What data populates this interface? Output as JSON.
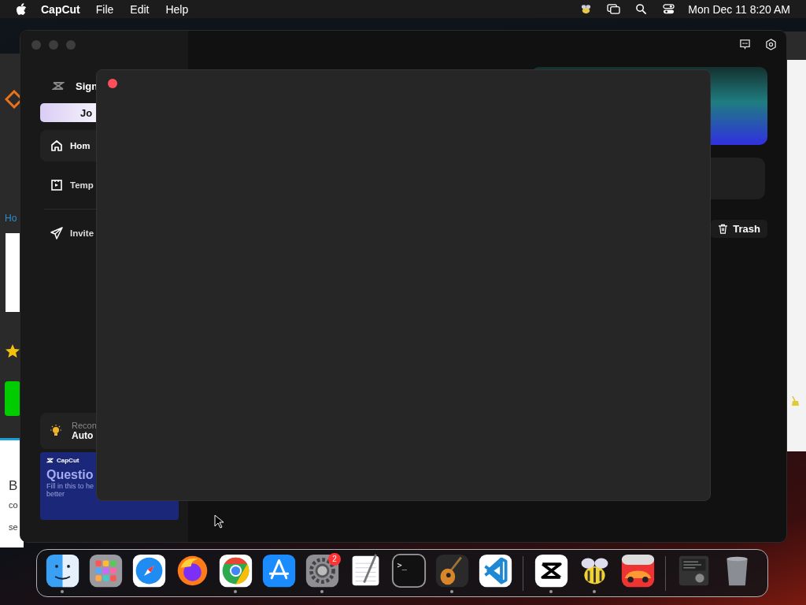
{
  "menu_bar": {
    "app_name": "CapCut",
    "menus": [
      "File",
      "Edit",
      "Help"
    ],
    "clock": "Mon Dec 11  8:20 AM"
  },
  "background_window": {
    "link": "Ho",
    "texts": [
      "B",
      "co",
      "se"
    ]
  },
  "capcut": {
    "sidebar": {
      "sign_in": "Sign",
      "join_button": "Jo",
      "nav": [
        {
          "label": "Hom",
          "kind": "home",
          "selected": true
        },
        {
          "label": "Temp",
          "kind": "template",
          "selected": false
        },
        {
          "label": "Invite",
          "kind": "send",
          "selected": false
        }
      ],
      "tip": {
        "title": "Recon",
        "value": "Auto"
      },
      "banner": {
        "brand": "CapCut",
        "title": "Questio",
        "text": "Fill in this to he",
        "text_2": "better"
      }
    },
    "trash_button": "Trash"
  },
  "dock": {
    "apps": [
      {
        "kind": "finder",
        "running": true
      },
      {
        "kind": "launchpad",
        "running": false
      },
      {
        "kind": "safari",
        "running": false
      },
      {
        "kind": "firefox",
        "running": false
      },
      {
        "kind": "chrome",
        "running": true
      },
      {
        "kind": "appstore",
        "running": false
      },
      {
        "kind": "settings",
        "running": true,
        "badge": "2"
      },
      {
        "kind": "textedit",
        "running": false
      },
      {
        "kind": "terminal",
        "running": false,
        "label": ">_"
      },
      {
        "kind": "guitar",
        "running": true
      },
      {
        "kind": "vscode",
        "running": false
      },
      {
        "kind": "separator"
      },
      {
        "kind": "capcut",
        "running": true
      },
      {
        "kind": "bee",
        "running": true
      },
      {
        "kind": "racing",
        "running": false
      },
      {
        "kind": "separator"
      },
      {
        "kind": "stack",
        "running": false
      },
      {
        "kind": "trash",
        "running": false
      }
    ]
  }
}
